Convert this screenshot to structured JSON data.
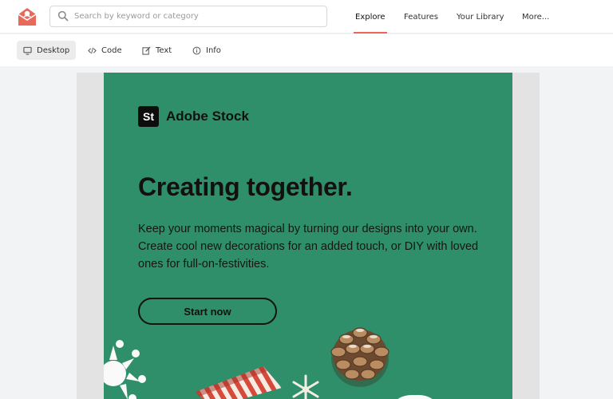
{
  "header": {
    "search": {
      "placeholder": "Search by keyword or category",
      "value": ""
    },
    "nav": [
      {
        "label": "Explore",
        "active": true
      },
      {
        "label": "Features"
      },
      {
        "label": "Your Library"
      },
      {
        "label": "More..."
      }
    ],
    "accent_color": "#e8685a"
  },
  "toolbar": {
    "views": [
      {
        "label": "Desktop",
        "icon": "monitor-icon",
        "active": true
      },
      {
        "label": "Code",
        "icon": "code-icon"
      },
      {
        "label": "Text",
        "icon": "edit-icon"
      },
      {
        "label": "Info",
        "icon": "info-icon"
      }
    ]
  },
  "email": {
    "brand_mark": "St",
    "brand_name": "Adobe Stock",
    "headline": "Creating together.",
    "body": "Keep your moments magical by turning our designs into your own. Create cool new decorations for an added touch, or DIY with loved ones for full-on-festivities.",
    "cta_label": "Start now",
    "background_color": "#2f8f6a"
  }
}
